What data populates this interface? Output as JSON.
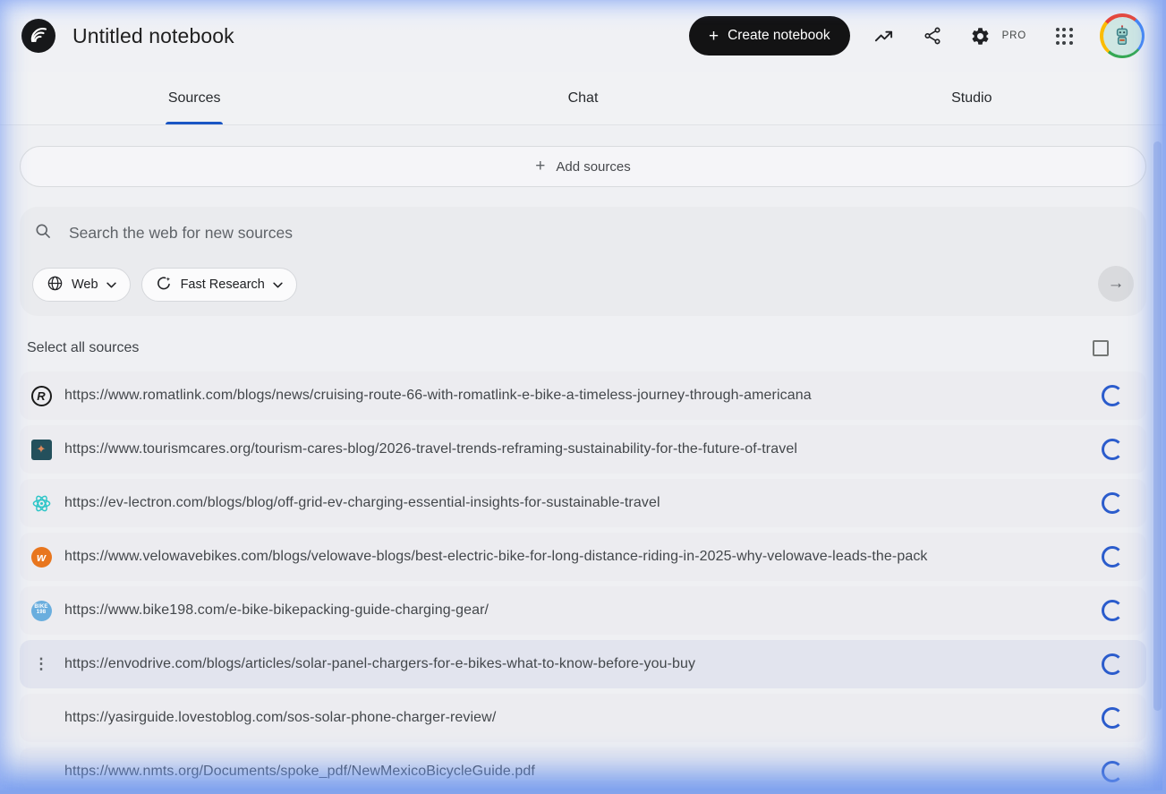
{
  "app": {
    "title": "Untitled notebook"
  },
  "header": {
    "create_button_label": "Create notebook",
    "pro_label": "PRO"
  },
  "tabs": [
    {
      "label": "Sources",
      "active": true
    },
    {
      "label": "Chat",
      "active": false
    },
    {
      "label": "Studio",
      "active": false
    }
  ],
  "sources_panel": {
    "add_sources_label": "Add sources",
    "search": {
      "placeholder": "Search the web for new sources",
      "source_type_label": "Web",
      "research_mode_label": "Fast Research",
      "submit_arrow": "→"
    },
    "select_all_label": "Select all sources",
    "select_all_checked": false
  },
  "sources": [
    {
      "url": "https://www.romatlink.com/blogs/news/cruising-route-66-with-romatlink-e-bike-a-timeless-journey-through-americana",
      "icon": "romatlink-favicon",
      "state": "loading",
      "hovered": false
    },
    {
      "url": "https://www.tourismcares.org/tourism-cares-blog/2026-travel-trends-reframing-sustainability-for-the-future-of-travel",
      "icon": "tourismcares-favicon",
      "state": "loading",
      "hovered": false
    },
    {
      "url": "https://ev-lectron.com/blogs/blog/off-grid-ev-charging-essential-insights-for-sustainable-travel",
      "icon": "ev-lectron-favicon",
      "state": "loading",
      "hovered": false
    },
    {
      "url": "https://www.velowavebikes.com/blogs/velowave-blogs/best-electric-bike-for-long-distance-riding-in-2025-why-velowave-leads-the-pack",
      "icon": "velowave-favicon",
      "state": "loading",
      "hovered": false
    },
    {
      "url": "https://www.bike198.com/e-bike-bikepacking-guide-charging-gear/",
      "icon": "bike198-favicon",
      "state": "loading",
      "hovered": false
    },
    {
      "url": "https://envodrive.com/blogs/articles/solar-panel-chargers-for-e-bikes-what-to-know-before-you-buy",
      "icon": "more-options-icon",
      "state": "loading",
      "hovered": true
    },
    {
      "url": "https://yasirguide.lovestoblog.com/sos-solar-phone-charger-review/",
      "icon": "none",
      "state": "loading",
      "hovered": false
    },
    {
      "url": "https://www.nmts.org/Documents/spoke_pdf/NewMexicoBicycleGuide.pdf",
      "icon": "none",
      "state": "loading",
      "hovered": false
    }
  ],
  "colors": {
    "accent_blue": "#1a56c4",
    "spinner_blue": "#2b5ccc",
    "button_black": "#131314",
    "row_bg": "#ececf0",
    "row_hover_bg": "#e2e4ee"
  }
}
